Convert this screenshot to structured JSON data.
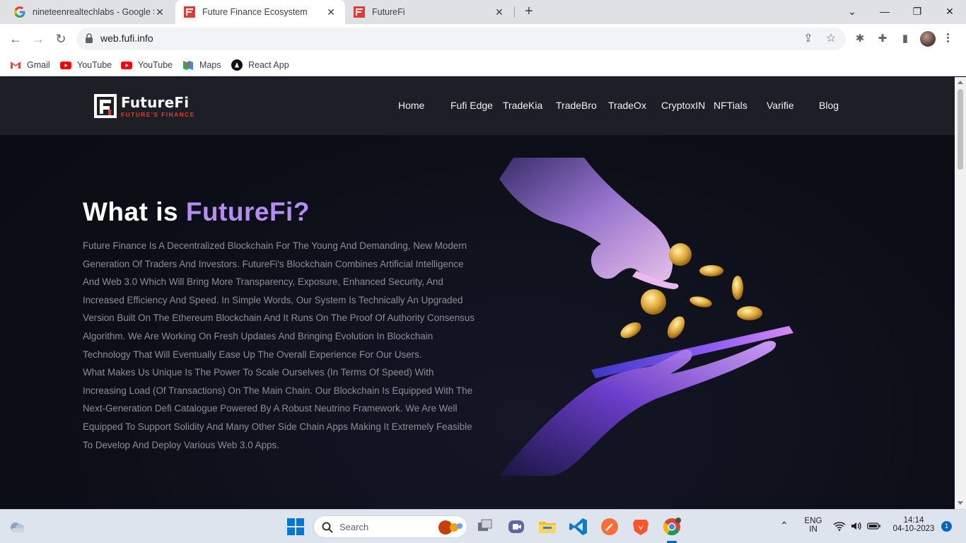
{
  "browser": {
    "tabs": [
      {
        "title": "nineteenrealtechlabs - Google S",
        "icon": "google-icon",
        "active": false
      },
      {
        "title": "Future Finance Ecosystem",
        "icon": "futurefi-favicon",
        "active": true
      },
      {
        "title": "FutureFi",
        "icon": "futurefi-favicon",
        "active": false
      }
    ],
    "new_tab": "+",
    "url": "web.fufi.info",
    "bookmarks": [
      {
        "label": "Gmail",
        "icon": "gmail-icon"
      },
      {
        "label": "YouTube",
        "icon": "youtube-icon"
      },
      {
        "label": "YouTube",
        "icon": "youtube-icon"
      },
      {
        "label": "Maps",
        "icon": "maps-icon"
      },
      {
        "label": "React App",
        "icon": "react-icon"
      }
    ]
  },
  "site": {
    "logo": {
      "name": "FutureFi",
      "tagline": "FUTURE'S FINANCE"
    },
    "nav": [
      "Home",
      "Fufi Edge",
      "TradeKia",
      "TradeBro",
      "TradeOx",
      "CryptoxIN",
      "NFTials",
      "Varifie",
      "Blog"
    ],
    "hero": {
      "title_prefix": "What is ",
      "title_accent": "FutureFi?",
      "paragraph1": "Future Finance Is A Decentralized Blockchain For The Young And Demanding, New Modern Generation Of Traders And Investors. FutureFi's Blockchain Combines Artificial Intelligence And Web 3.0 Which Will Bring More Transparency, Exposure, Enhanced Security, And Increased Efficiency And Speed. In Simple Words, Our System Is Technically An Upgraded Version Built On The Ethereum Blockchain And It Runs On The Proof Of Authority Consensus Algorithm. We Are Working On Fresh Updates And Bringing Evolution In Blockchain Technology That Will Eventually Ease Up The Overall Experience For Our Users.",
      "paragraph2": "What Makes Us Unique Is The Power To Scale Ourselves (In Terms Of Speed) With Increasing Load (Of Transactions) On The Main Chain. Our Blockchain Is Equipped With The Next-Generation Defi Catalogue Powered By A Robust Neutrino Framework. We Are Well Equipped To Support Solidity And Many Other Side Chain Apps Making It Extremely Feasible To Develop And Deploy Various Web 3.0 Apps."
    },
    "colors": {
      "header_bg": "#1d1f27",
      "accent": "#b48cf2",
      "logo_red": "#e53935"
    }
  },
  "taskbar": {
    "search_label": "Search",
    "language": "ENG",
    "region": "IN",
    "time": "14:14",
    "date": "04-10-2023",
    "notifications": "1"
  }
}
